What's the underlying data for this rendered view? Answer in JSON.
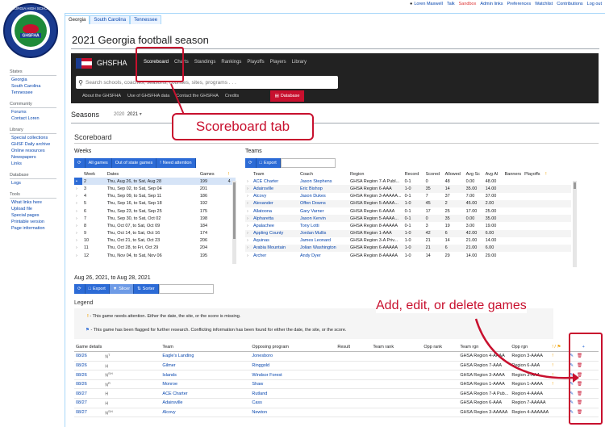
{
  "topbar": {
    "user": "Loren Maxwell",
    "links": [
      "Talk",
      "Sandbox",
      "Admin links",
      "Preferences",
      "Watchlist",
      "Contributions",
      "Log out"
    ]
  },
  "logo": {
    "line1": "GEORGIA HIGH SCHOOL",
    "line2": "GHSFHA"
  },
  "sidebar": {
    "states": {
      "heading": "States",
      "items": [
        "Georgia",
        "South Carolina",
        "Tennessee"
      ]
    },
    "community": {
      "heading": "Community",
      "items": [
        "Forums",
        "Contact Loren"
      ]
    },
    "library": {
      "heading": "Library",
      "items": [
        "Special collections",
        "GHSF Daily archive",
        "Online resources",
        "Newspapers",
        "Links"
      ]
    },
    "database": {
      "heading": "Database",
      "items": [
        "Logs"
      ]
    },
    "tools": {
      "heading": "Tools",
      "items": [
        "What links here",
        "Upload file",
        "Special pages",
        "Printable version",
        "Page information"
      ]
    }
  },
  "tabs": [
    "Georgia",
    "South Carolina",
    "Tennessee"
  ],
  "page_title": "2021 Georgia football season",
  "nav": {
    "title": "GHSFHA",
    "links": [
      "Scoreboard",
      "Charts",
      "Standings",
      "Rankings",
      "Playoffs",
      "Players",
      "Library"
    ],
    "search_placeholder": "Search schools, coaches, seasons, counties, sites, programs . . .",
    "sublinks": [
      "About the GHSFHA",
      "Use of GHSFHA data",
      "Contact the GHSFHA",
      "Credits"
    ],
    "database_button": "Database"
  },
  "seasons": {
    "label": "Seasons",
    "prev": "2020",
    "current": "2021"
  },
  "scoreboard": {
    "heading": "Scoreboard"
  },
  "weeks": {
    "heading": "Weeks",
    "buttons": [
      "All games",
      "Out of state games",
      "Need attention"
    ],
    "columns": [
      "Week",
      "Dates",
      "Games",
      "!"
    ],
    "rows": [
      {
        "week": "2",
        "dates": "Thu, Aug 26, to Sat, Aug 28",
        "games": "199",
        "flag": "4"
      },
      {
        "week": "3",
        "dates": "Thu, Sep 02, to Sat, Sep 04",
        "games": "201",
        "flag": ""
      },
      {
        "week": "4",
        "dates": "Thu, Sep 09, to Sat, Sep 11",
        "games": "186",
        "flag": ""
      },
      {
        "week": "5",
        "dates": "Thu, Sep 16, to Sat, Sep 18",
        "games": "192",
        "flag": ""
      },
      {
        "week": "6",
        "dates": "Thu, Sep 23, to Sat, Sep 25",
        "games": "175",
        "flag": ""
      },
      {
        "week": "7",
        "dates": "Thu, Sep 30, to Sat, Oct 02",
        "games": "198",
        "flag": ""
      },
      {
        "week": "8",
        "dates": "Thu, Oct 07, to Sat, Oct 09",
        "games": "184",
        "flag": ""
      },
      {
        "week": "9",
        "dates": "Thu, Oct 14, to Sat, Oct 16",
        "games": "174",
        "flag": ""
      },
      {
        "week": "10",
        "dates": "Thu, Oct 21, to Sat, Oct 23",
        "games": "206",
        "flag": ""
      },
      {
        "week": "11",
        "dates": "Thu, Oct 28, to Fri, Oct 29",
        "games": "204",
        "flag": ""
      },
      {
        "week": "12",
        "dates": "Thu, Nov 04, to Sat, Nov 06",
        "games": "195",
        "flag": ""
      }
    ]
  },
  "teams": {
    "heading": "Teams",
    "export": "Export",
    "columns": [
      "Team",
      "Coach",
      "Region",
      "Record",
      "Scored",
      "Allowed",
      "Avg Sc",
      "Avg Al",
      "Banners",
      "Playoffs",
      "!"
    ],
    "rows": [
      [
        "ACE Charter",
        "Jason Stephens",
        "GHSA Region 7-A Publ...",
        "0-1",
        "0",
        "48",
        "0.00",
        "48.00"
      ],
      [
        "Adairsville",
        "Eric Bishop",
        "GHSA Region 6-AAA",
        "1-0",
        "35",
        "14",
        "35.00",
        "14.00"
      ],
      [
        "Alcovy",
        "Jason Dukes",
        "GHSA Region 3-AAAAA...",
        "0-1",
        "7",
        "37",
        "7.00",
        "37.00"
      ],
      [
        "Alexander",
        "Offen Downs",
        "GHSA Region 5-AAAA...",
        "1-0",
        "45",
        "2",
        "45.00",
        "2.00"
      ],
      [
        "Allatoona",
        "Gary Varner",
        "GHSA Region 6-AAAA",
        "0-1",
        "17",
        "25",
        "17.00",
        "25.00"
      ],
      [
        "Alpharetta",
        "Jason Kervin",
        "GHSA Region 5-AAAA...",
        "0-1",
        "0",
        "35",
        "0.00",
        "35.00"
      ],
      [
        "Apalachee",
        "Tony Lotti",
        "GHSA Region 8-AAAAA",
        "0-1",
        "3",
        "19",
        "3.00",
        "19.00"
      ],
      [
        "Appling County",
        "Jordan Mullis",
        "GHSA Region 1-AAA",
        "1-0",
        "42",
        "6",
        "42.00",
        "6.00"
      ],
      [
        "Aquinas",
        "James Leonard",
        "GHSA Region 3-A Priv...",
        "1-0",
        "21",
        "14",
        "21.00",
        "14.00"
      ],
      [
        "Arabia Mountain",
        "Jolian Washington",
        "GHSA Region 6-AAAAA",
        "1-0",
        "21",
        "6",
        "21.00",
        "6.00"
      ],
      [
        "Archer",
        "Andy Dyer",
        "GHSA Region 8-AAAAA",
        "1-0",
        "14",
        "29",
        "14.00",
        "29.00"
      ]
    ]
  },
  "selected_range": {
    "label": "Aug 26, 2021, to Aug 28, 2021",
    "buttons": [
      "Export",
      "Slicer",
      "Sorter"
    ]
  },
  "legend": {
    "heading": "Legend",
    "attention": "- This game needs attention. Either the date, the site, or the score is missing.",
    "flagged": "- This game has been flagged for further research. Conflicting information has been found for either the date, the site, or the score."
  },
  "games": {
    "columns": [
      "Game details",
      "Team",
      "Opposing program",
      "Result",
      "Team rank",
      "Opp rank",
      "Team rgn",
      "Opp rgn",
      "! / ⚑",
      "+"
    ],
    "rows": [
      {
        "date": "08/26",
        "ha": "N",
        "sup": "T",
        "team": "Eagle's Landing",
        "opp": "Jonesboro",
        "trgn": "GHSA Region 4-AAAA",
        "orgn": "Region 3-AAAA"
      },
      {
        "date": "08/26",
        "ha": "H",
        "sup": "",
        "team": "Gilmer",
        "opp": "Ringgold",
        "trgn": "GHSA Region 7-AAA",
        "orgn": "Region 6-AAA"
      },
      {
        "date": "08/26",
        "ha": "N",
        "sup": "SH",
        "team": "Islands",
        "opp": "Windsor Forest",
        "trgn": "GHSA Region 3-AAAA",
        "orgn": "Region 3-AAA"
      },
      {
        "date": "08/26",
        "ha": "N",
        "sup": "R",
        "team": "Monroe",
        "opp": "Shaw",
        "trgn": "GHSA Region 1-AAAA",
        "orgn": "Region 1-AAAA"
      },
      {
        "date": "08/27",
        "ha": "H",
        "sup": "",
        "team": "ACE Charter",
        "opp": "Rutland",
        "trgn": "GHSA Region 7-A Pub...",
        "orgn": "Region 4-AAAA"
      },
      {
        "date": "08/27",
        "ha": "H",
        "sup": "",
        "team": "Adairsville",
        "opp": "Cass",
        "trgn": "GHSA Region 6-AAA",
        "orgn": "Region 7-AAAAA"
      },
      {
        "date": "08/27",
        "ha": "N",
        "sup": "SH",
        "team": "Alcovy",
        "opp": "Newton",
        "trgn": "GHSA Region 3-AAAAA",
        "orgn": "Region 4-AAAAAA"
      }
    ]
  },
  "annotations": {
    "scoreboard_tab": "Scoreboard tab",
    "add_edit": "Add, edit, or delete games"
  },
  "colors": {
    "accent": "#2c6bd6",
    "annotation": "#c8102e",
    "navbar": "#222222"
  }
}
